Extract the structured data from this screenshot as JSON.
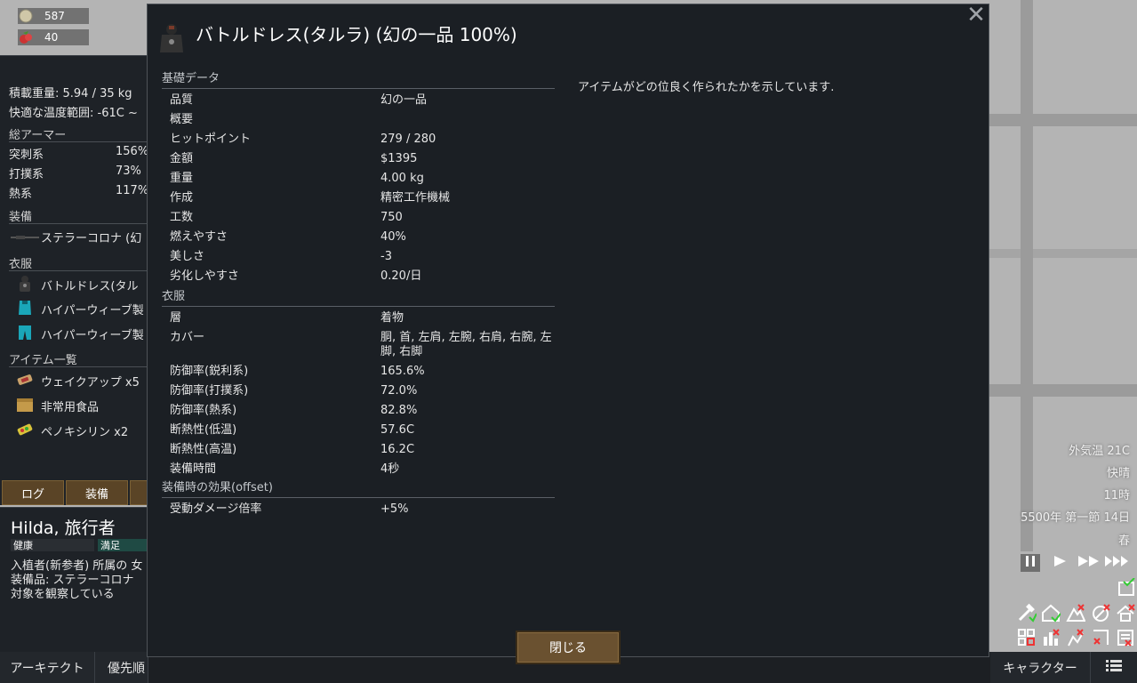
{
  "resources": [
    {
      "icon": "silver-icon",
      "value": "587"
    },
    {
      "icon": "berries-icon",
      "value": "40"
    }
  ],
  "inspect": {
    "mass": "積載重量: 5.94 / 35 kg",
    "comfy_temp": "快適な温度範囲: -61C ~",
    "armor_header": "総アーマー",
    "armor": [
      {
        "label": "突刺系",
        "value": "156%"
      },
      {
        "label": "打撲系",
        "value": "73%"
      },
      {
        "label": "熱系",
        "value": "117%"
      }
    ],
    "equipment_header": "装備",
    "equipment": [
      {
        "icon": "rifle-icon",
        "label": "ステラーコロナ (幻"
      }
    ],
    "apparel_header": "衣服",
    "apparel": [
      {
        "icon": "battle-dress-icon",
        "label": "バトルドレス(タル"
      },
      {
        "icon": "hyperweave-shirt-icon",
        "label": "ハイパーウィーブ製"
      },
      {
        "icon": "hyperweave-pants-icon",
        "label": "ハイパーウィーブ製"
      }
    ],
    "items_header": "アイテム一覧",
    "items": [
      {
        "icon": "wake-up-icon",
        "label": "ウェイクアップ x5"
      },
      {
        "icon": "packaged-meal-icon",
        "label": "非常用食品"
      },
      {
        "icon": "penoxycyline-icon",
        "label": "ペノキシリン x2"
      }
    ]
  },
  "tabs": {
    "log": "ログ",
    "gear": "装備"
  },
  "pawn": {
    "name": "Hilda, 旅行者",
    "health_bar": "健康",
    "mood_bar": "満足",
    "line1": "入植者(新参者) 所属の 女",
    "line2": "装備品: ステラーコロナ",
    "line3": "対象を観察している"
  },
  "bottom_bar": {
    "architect": "アーキテクト",
    "work": "優先順",
    "character": "キャラクター"
  },
  "world": {
    "outdoor_temp": "外気温 21C",
    "weather": "快晴",
    "hour": "11時",
    "date": "5500年 第一節 14日",
    "season": "春"
  },
  "dialog": {
    "title": "バトルドレス(タルラ) (幻の一品 100%)",
    "description": "アイテムがどの位良く作られたかを示しています.",
    "close_button": "閉じる",
    "sections": [
      {
        "header": "基礎データ",
        "rows": [
          {
            "label": "品質",
            "value": "幻の一品"
          },
          {
            "label": "概要",
            "value": ""
          },
          {
            "label": "ヒットポイント",
            "value": "279 / 280"
          },
          {
            "label": "金額",
            "value": "$1395"
          },
          {
            "label": "重量",
            "value": "4.00 kg"
          },
          {
            "label": "作成",
            "value": "精密工作機械"
          },
          {
            "label": "工数",
            "value": "750"
          },
          {
            "label": "燃えやすさ",
            "value": "40%"
          },
          {
            "label": "美しさ",
            "value": "-3"
          },
          {
            "label": "劣化しやすさ",
            "value": "0.20/日"
          }
        ]
      },
      {
        "header": "衣服",
        "rows": [
          {
            "label": "層",
            "value": "着物"
          },
          {
            "label": "カバー",
            "value": "胴, 首, 左肩, 左腕, 右肩, 右腕, 左脚, 右脚",
            "tall": true
          },
          {
            "label": "防御率(鋭利系)",
            "value": "165.6%"
          },
          {
            "label": "防御率(打撲系)",
            "value": "72.0%"
          },
          {
            "label": "防御率(熱系)",
            "value": "82.8%"
          },
          {
            "label": "断熱性(低温)",
            "value": "57.6C"
          },
          {
            "label": "断熱性(高温)",
            "value": "16.2C"
          },
          {
            "label": "装備時間",
            "value": "4秒"
          }
        ]
      },
      {
        "header": "装備時の効果(offset)",
        "rows": [
          {
            "label": "受動ダメージ倍率",
            "value": "+5%"
          }
        ]
      }
    ]
  }
}
